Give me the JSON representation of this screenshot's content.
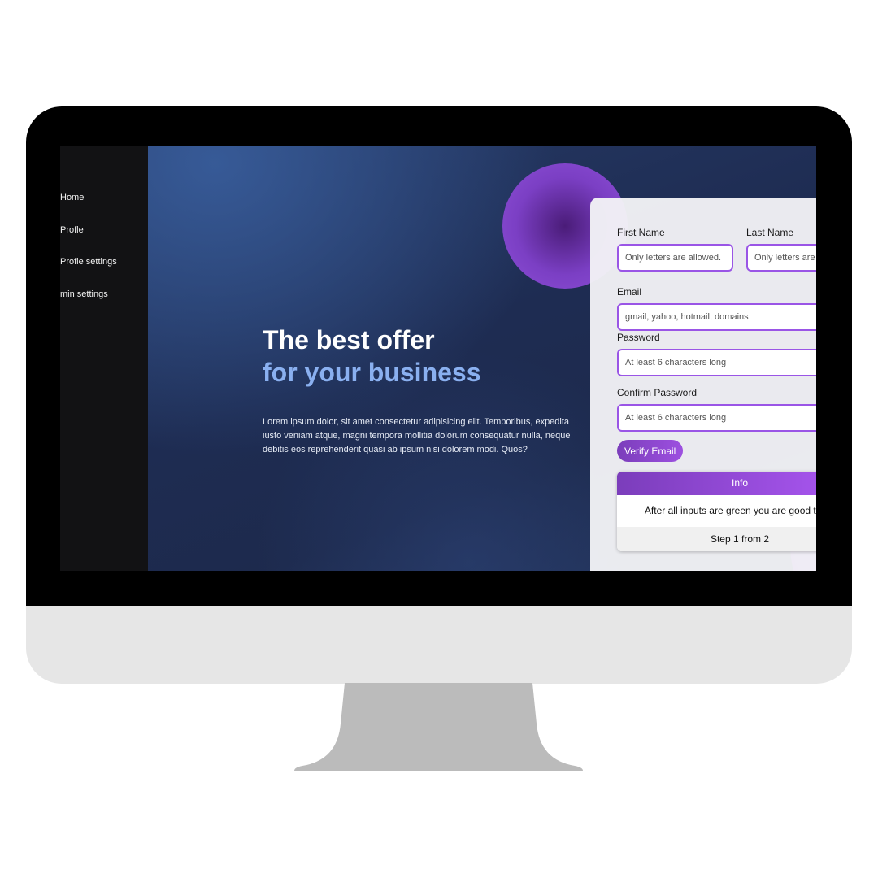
{
  "sidebar": {
    "items": [
      {
        "label": "Home"
      },
      {
        "label": "Profle"
      },
      {
        "label": "Profle settings"
      },
      {
        "label": "min settings"
      }
    ]
  },
  "hero": {
    "title_line1": "The best offer",
    "title_line2": "for your business",
    "body": "Lorem ipsum dolor, sit amet consectetur adipisicing elit. Temporibus, expedita iusto veniam atque, magni tempora mollitia dolorum consequatur nulla, neque debitis eos reprehenderit quasi ab ipsum nisi dolorem modi. Quos?"
  },
  "form": {
    "first_name": {
      "label": "First Name",
      "placeholder": "Only letters are allowed."
    },
    "last_name": {
      "label": "Last Name",
      "placeholder": "Only letters are allowed."
    },
    "email": {
      "label": "Email",
      "placeholder": "gmail, yahoo, hotmail, domains"
    },
    "password": {
      "label": "Password",
      "placeholder": "At least 6 characters long"
    },
    "confirm_password": {
      "label": "Confirm Password",
      "placeholder": "At least 6 characters long"
    },
    "verify_button": "Verify Email",
    "info": {
      "header": "Info",
      "message": "After all inputs are green you are good to go",
      "step": "Step 1 from 2"
    }
  },
  "colors": {
    "accent_purple": "#9a55e6",
    "hero_accent": "#8ab0f0",
    "sidebar_bg": "#121214"
  }
}
